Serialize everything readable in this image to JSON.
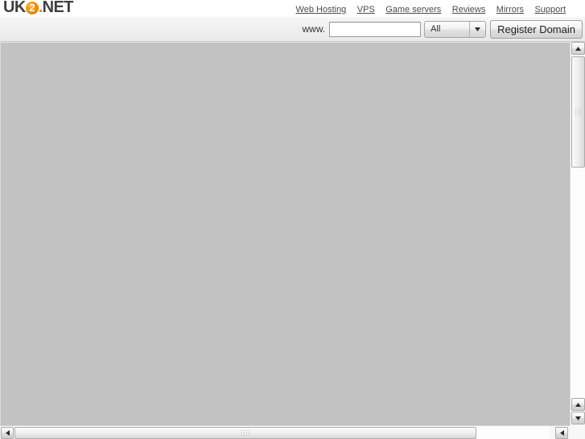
{
  "brand": {
    "logo_part1": "UK",
    "logo_circle": "2",
    "logo_dot": ".",
    "logo_part2": "NET",
    "accent_color": "#f08a00",
    "text_color": "#3f3f3f"
  },
  "topnav": {
    "items": [
      {
        "label": "Web Hosting"
      },
      {
        "label": "VPS"
      },
      {
        "label": "Game servers"
      },
      {
        "label": "Reviews"
      },
      {
        "label": "Mirrors"
      },
      {
        "label": "Support"
      }
    ]
  },
  "toolbar": {
    "www_prefix": "www.",
    "domain_value": "",
    "domain_placeholder": "",
    "tld_selected": "All",
    "tld_options": [
      "All"
    ],
    "register_label": "Register Domain"
  },
  "content": {
    "background_color": "#c2c2c2",
    "body_text": ""
  },
  "scrollbars": {
    "vertical": {
      "up_icon": "triangle-up-icon",
      "down_icon": "triangle-down-icon",
      "thumb_grip_icon": "grip-dots-icon"
    },
    "horizontal": {
      "left_icon": "triangle-left-icon",
      "right_icon": "triangle-right-icon",
      "thumb_grip_icon": "grip-dots-icon"
    }
  }
}
